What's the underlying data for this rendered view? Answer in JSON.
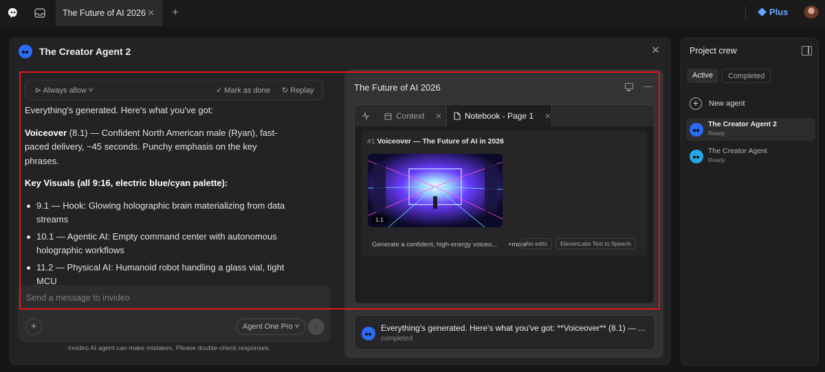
{
  "topbar": {
    "tab_title": "The Future of AI 2026",
    "plan_label": "Plus"
  },
  "panel": {
    "title": "The Creator Agent 2"
  },
  "chat": {
    "toolbar": {
      "always_allow": "⊳ Always allow ˅",
      "mark_done": "✓ Mark as done",
      "replay": "↻ Replay"
    },
    "intro": "Everything's generated. Here's what you've got:",
    "voiceover_label": "Voiceover",
    "voiceover_text": " (8.1) — Confident North American male (Ryan), fast-paced delivery, ~45 seconds. Punchy emphasis on the key phrases.",
    "key_visuals_heading": "Key Visuals (all 9:16, electric blue/cyan palette):",
    "visuals": [
      "9.1 — Hook: Glowing holographic brain materializing from data streams",
      "10.1 — Agentic AI: Empty command center with autonomous holographic workflows",
      "11.2 — Physical AI: Humanoid robot handling a glass vial, tight MCU"
    ],
    "input_placeholder": "Send a message to invideo",
    "model": "Agent One Pro ˅",
    "disclaimer": "invideo AI agent can make mistakes. Please double-check responses."
  },
  "preview": {
    "title": "The Future of AI 2026",
    "tabs": [
      {
        "label": "Context"
      },
      {
        "label": "Notebook - Page 1"
      }
    ],
    "card": {
      "number": "#1",
      "title": "Voiceover — The Future of AI in 2026",
      "thumb_badge": "1.1",
      "prompt": "Generate a confident, high-energy voiceo...",
      "more": "+more",
      "edits": "No edits",
      "tool": "ElevenLabs Text to Speech"
    }
  },
  "status_card": {
    "text": "Everything's generated. Here's what you've got: **Voiceover** (8.1) — ...",
    "sub": "completed"
  },
  "crew": {
    "title": "Project crew",
    "tabs": [
      "Active",
      "Completed"
    ],
    "new_agent": "New agent",
    "agents": [
      {
        "name": "The Creator Agent 2",
        "status": "Ready"
      },
      {
        "name": "The Creator Agent",
        "status": "Ready"
      }
    ]
  },
  "colors": {
    "accent": "#69a6ff",
    "agent_blue": "#2a6cf6",
    "agent_cyan": "#25a8e6",
    "highlight": "#e8141b"
  }
}
